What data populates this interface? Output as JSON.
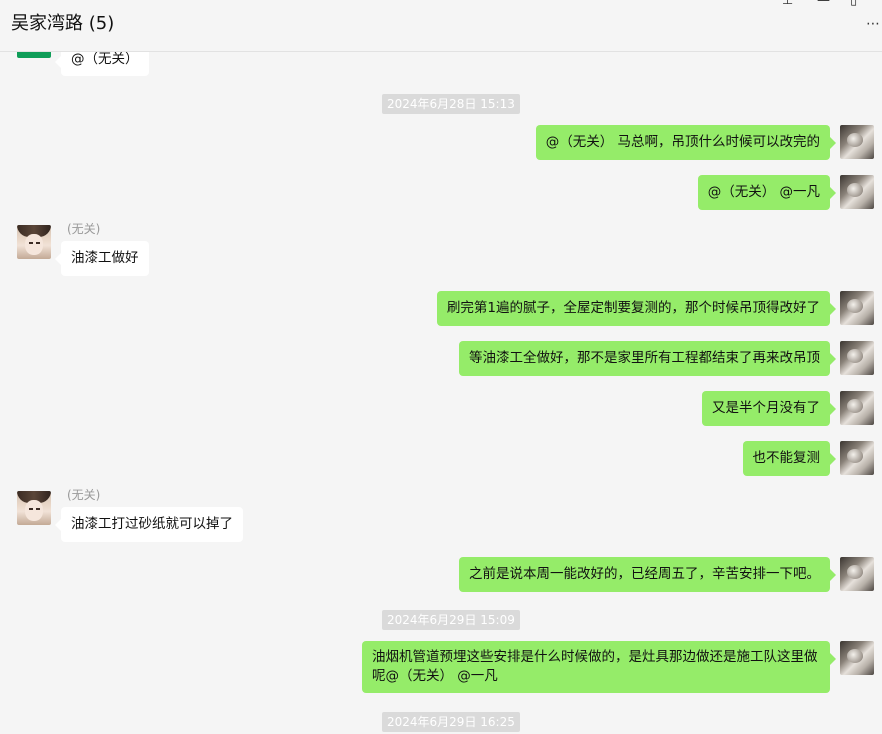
{
  "window": {
    "title": "吴家湾路 (5)",
    "pin_icon": "pin-icon",
    "minimize_icon": "minimize-icon",
    "maximize_icon": "maximize-icon",
    "more_icon": "more-icon"
  },
  "colors": {
    "outgoing_bubble": "#95ec69",
    "incoming_bubble": "#ffffff",
    "background": "#f5f5f5",
    "timestamp_bg": "#dadada"
  },
  "messages": {
    "m0_text": "@（无关）",
    "ts1": "2024年6月28日 15:13",
    "m1_text": "@（无关） 马总啊，吊顶什么时候可以改完的",
    "m2_text": "@（无关） @一凡",
    "m3_sender": "(无关)",
    "m3_text": "油漆工做好",
    "m4_text": "刷完第1遍的腻子，全屋定制要复测的，那个时候吊顶得改好了",
    "m5_text": "等油漆工全做好，那不是家里所有工程都结束了再来改吊顶",
    "m6_text": "又是半个月没有了",
    "m7_text": "也不能复测",
    "m8_sender": "(无关)",
    "m8_text": "油漆工打过砂纸就可以掉了",
    "m9_text": "之前是说本周一能改好的，已经周五了，辛苦安排一下吧。",
    "ts2": "2024年6月29日 15:09",
    "m10_text": "油烟机管道预埋这些安排是什么时候做的，是灶具那边做还是施工队这里做呢@（无关） @一凡",
    "ts3": "2024年6月29日 16:25"
  }
}
